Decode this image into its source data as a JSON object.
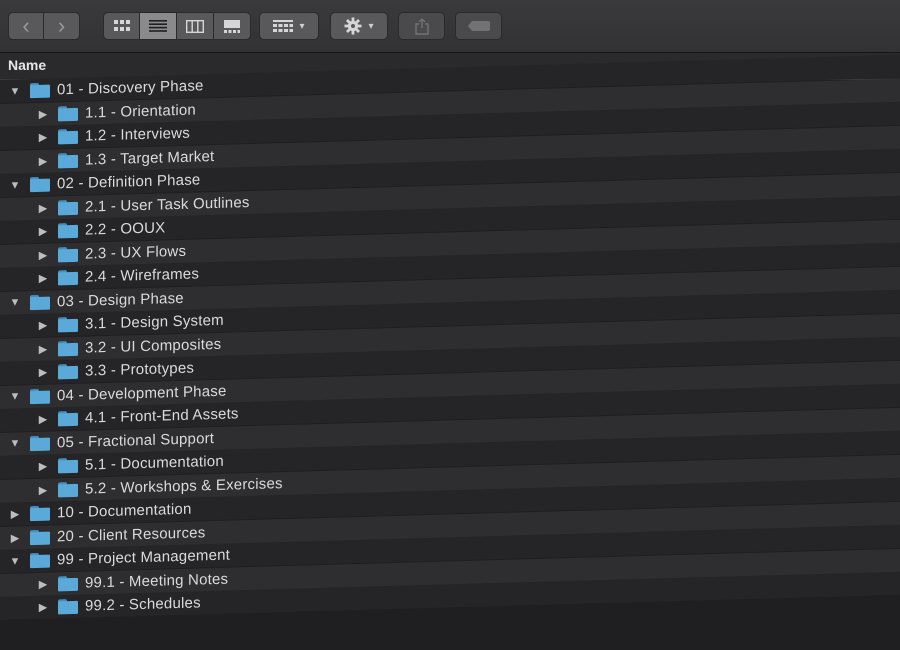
{
  "toolbar": {
    "nav": [
      {
        "name": "back-button",
        "icon": "chevron-left-icon",
        "glyph": "‹"
      },
      {
        "name": "forward-button",
        "icon": "chevron-right-icon",
        "glyph": "›"
      }
    ],
    "view_modes": [
      {
        "name": "view-icons-button",
        "icon": "grid-icon",
        "selected": false
      },
      {
        "name": "view-list-button",
        "icon": "list-icon",
        "selected": true
      },
      {
        "name": "view-columns-button",
        "icon": "columns-icon",
        "selected": false
      },
      {
        "name": "view-gallery-button",
        "icon": "gallery-icon",
        "selected": false
      }
    ],
    "group_by": {
      "icon": "group-grid-icon"
    },
    "action": {
      "icon": "gear-icon"
    },
    "share": {
      "icon": "share-icon",
      "enabled": false
    },
    "tags": {
      "icon": "tag-icon",
      "enabled": false
    }
  },
  "list": {
    "column_header": "Name",
    "rows": [
      {
        "label": "01 - Discovery Phase",
        "level": 0,
        "expanded": true
      },
      {
        "label": "1.1 - Orientation",
        "level": 1,
        "expanded": false
      },
      {
        "label": "1.2 - Interviews",
        "level": 1,
        "expanded": false
      },
      {
        "label": "1.3 - Target Market",
        "level": 1,
        "expanded": false
      },
      {
        "label": "02 - Definition Phase",
        "level": 0,
        "expanded": true
      },
      {
        "label": "2.1 - User Task Outlines",
        "level": 1,
        "expanded": false
      },
      {
        "label": "2.2 - OOUX",
        "level": 1,
        "expanded": false
      },
      {
        "label": "2.3 - UX Flows",
        "level": 1,
        "expanded": false
      },
      {
        "label": "2.4 - Wireframes",
        "level": 1,
        "expanded": false
      },
      {
        "label": "03 - Design Phase",
        "level": 0,
        "expanded": true
      },
      {
        "label": "3.1 - Design System",
        "level": 1,
        "expanded": false
      },
      {
        "label": "3.2 - UI Composites",
        "level": 1,
        "expanded": false
      },
      {
        "label": "3.3 - Prototypes",
        "level": 1,
        "expanded": false
      },
      {
        "label": "04 - Development Phase",
        "level": 0,
        "expanded": true
      },
      {
        "label": "4.1 - Front-End Assets",
        "level": 1,
        "expanded": false
      },
      {
        "label": "05 - Fractional Support",
        "level": 0,
        "expanded": true
      },
      {
        "label": "5.1 - Documentation",
        "level": 1,
        "expanded": false
      },
      {
        "label": "5.2 - Workshops & Exercises",
        "level": 1,
        "expanded": false
      },
      {
        "label": "10 - Documentation",
        "level": 0,
        "expanded": false
      },
      {
        "label": "20 - Client Resources",
        "level": 0,
        "expanded": false
      },
      {
        "label": "99 - Project Management",
        "level": 0,
        "expanded": true
      },
      {
        "label": "99.1 - Meeting Notes",
        "level": 1,
        "expanded": false
      },
      {
        "label": "99.2 - Schedules",
        "level": 1,
        "expanded": false
      }
    ]
  },
  "colors": {
    "folder": "#5aa9d8",
    "folder_tab": "#3f8fbf",
    "row_odd": "#252527",
    "row_even": "#2e2e30"
  }
}
